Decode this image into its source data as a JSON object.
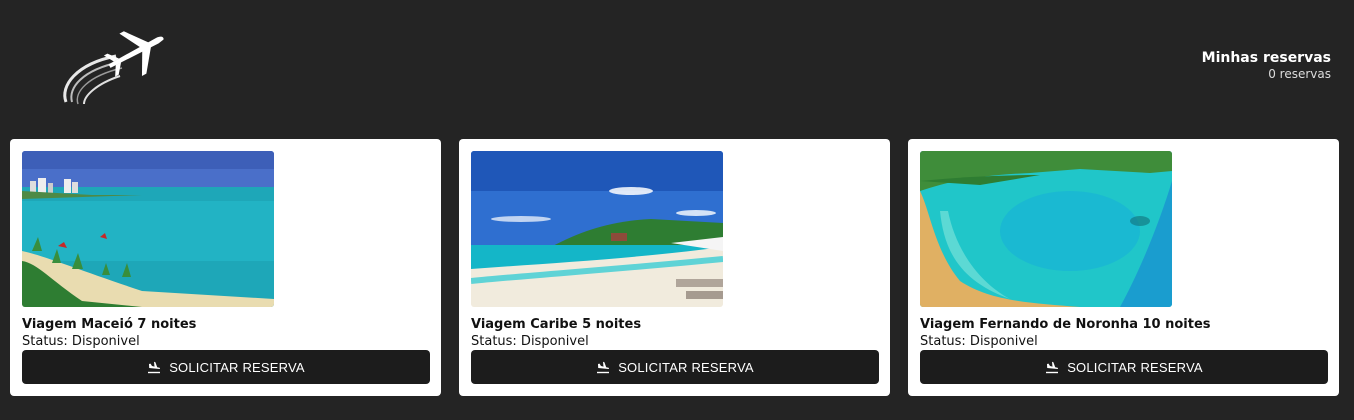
{
  "header": {
    "logo_icon": "airplane-icon",
    "reservations_title": "Minhas reservas",
    "reservations_count": "0 reservas"
  },
  "trips": [
    {
      "name": "Viagem Maceió 7 noites",
      "status": "Status: Disponivel",
      "button_label": "SOLICITAR RESERVA",
      "button_icon": "flight-land-icon"
    },
    {
      "name": "Viagem Caribe 5 noites",
      "status": "Status: Disponivel",
      "button_label": "SOLICITAR RESERVA",
      "button_icon": "flight-land-icon"
    },
    {
      "name": "Viagem Fernando de Noronha 10 noites",
      "status": "Status: Disponivel",
      "button_label": "SOLICITAR RESERVA",
      "button_icon": "flight-land-icon"
    }
  ]
}
